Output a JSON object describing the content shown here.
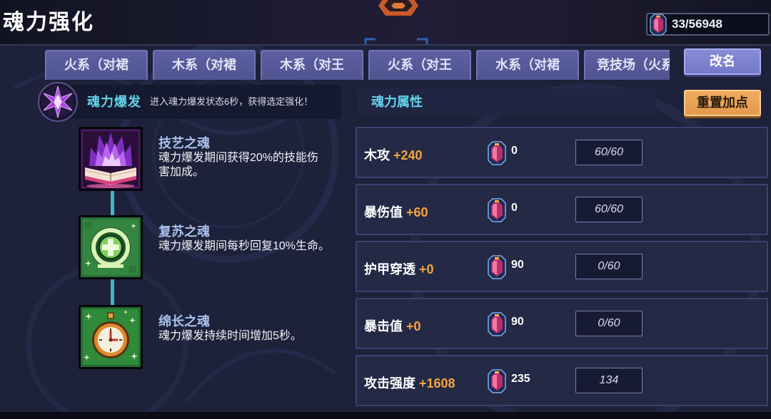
{
  "header": {
    "title": "魂力强化",
    "emblem_icon": "orange-gem-emblem-icon",
    "currency": {
      "icon": "soul-crystal-icon",
      "value": "33/56948"
    }
  },
  "tabs": [
    {
      "label": "火系（对裙"
    },
    {
      "label": "木系（对裙"
    },
    {
      "label": "木系（对王"
    },
    {
      "label": "火系（对王"
    },
    {
      "label": "水系（对裙"
    },
    {
      "label": "竞技场（火系"
    }
  ],
  "rename_button": {
    "label": "改名"
  },
  "soul_burst": {
    "icon": "soul-burst-crystal-icon",
    "title": "魂力爆发",
    "description": "进入魂力爆发状态6秒，获得选定强化！"
  },
  "souls": [
    {
      "icon": "purple-flame-book-icon",
      "name": "技艺之魂",
      "description": "魂力爆发期间获得20%的技能伤害加成。"
    },
    {
      "icon": "green-revive-plus-icon",
      "name": "复苏之魂",
      "description": "魂力爆发期间每秒回复10%生命。"
    },
    {
      "icon": "pocket-watch-icon",
      "name": "绵长之魂",
      "description": "魂力爆发持续时间增加5秒。"
    }
  ],
  "attributes": {
    "title": "魂力属性",
    "reset_button": {
      "label": "重置加点"
    },
    "cost_icon": "soul-crystal-icon",
    "rows": [
      {
        "name": "木攻",
        "bonus": "+240",
        "cost": "0",
        "points": "60/60"
      },
      {
        "name": "暴伤值",
        "bonus": "+60",
        "cost": "0",
        "points": "60/60"
      },
      {
        "name": "护甲穿透",
        "bonus": "+0",
        "cost": "90",
        "points": "0/60"
      },
      {
        "name": "暴击值",
        "bonus": "+0",
        "cost": "90",
        "points": "0/60"
      },
      {
        "name": "攻击强度",
        "bonus": "+1608",
        "cost": "235",
        "points": "134"
      }
    ]
  },
  "colors": {
    "accent": "#63d3ea",
    "bonus": "#f4a63c",
    "soul_name": "#a9c1ee",
    "tab": "#50548f",
    "rename_button": "#7479c8",
    "reset_button": "#e39a4f"
  }
}
